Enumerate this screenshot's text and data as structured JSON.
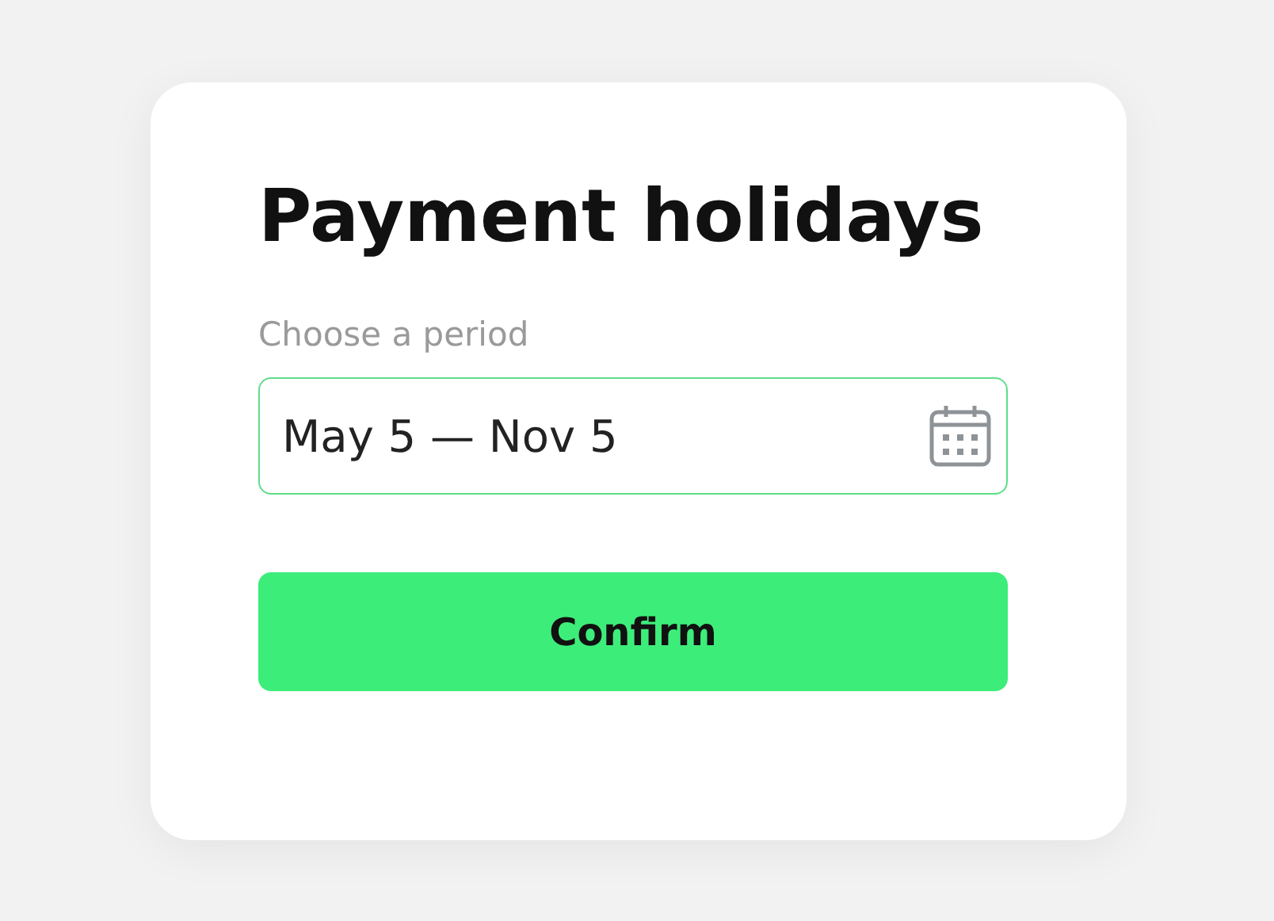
{
  "title": "Payment holidays",
  "period_field": {
    "label": "Choose a period",
    "value": "May 5 — Nov 5"
  },
  "confirm_button": {
    "label": "Confirm"
  }
}
